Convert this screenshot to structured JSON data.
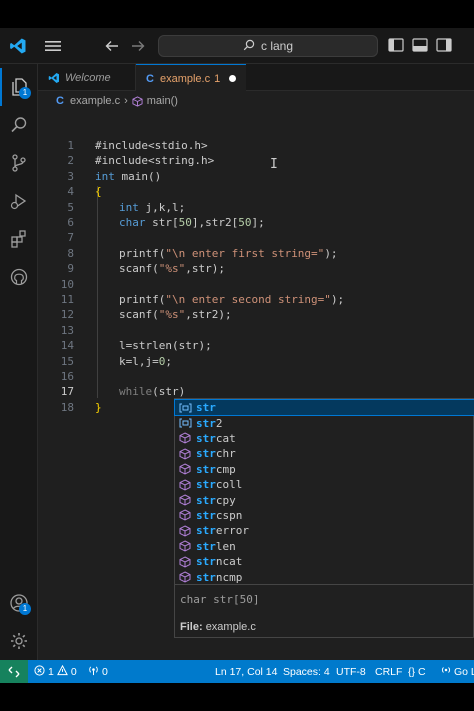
{
  "search": {
    "text": "c lang"
  },
  "activity": {
    "explorer_badge": "1",
    "account_badge": "1"
  },
  "tabs": [
    {
      "label": "Welcome"
    },
    {
      "label": "example.c",
      "problems": "1"
    }
  ],
  "breadcrumb": {
    "file": "example.c",
    "symbol": "main()"
  },
  "editor": {
    "current_line": 17,
    "lines": [
      "#include<stdio.h>",
      "#include<string.h>",
      "int main()",
      "{",
      "int j,k,l;",
      "char str[50],str2[50];",
      "",
      "printf(\"\\n enter first string=\");",
      "scanf(\"%s\",str);",
      "",
      "printf(\"\\n enter second string=\");",
      "scanf(\"%s\",str2);",
      "",
      "l=strlen(str);",
      "k=l,j=0;",
      "",
      "while(str)",
      "}"
    ]
  },
  "suggest": {
    "typed": "str",
    "items": [
      {
        "label": "str",
        "kind": "variable-icon"
      },
      {
        "label": "str2",
        "kind": "variable-icon"
      },
      {
        "label": "strcat",
        "kind": "function-icon"
      },
      {
        "label": "strchr",
        "kind": "function-icon"
      },
      {
        "label": "strcmp",
        "kind": "function-icon"
      },
      {
        "label": "strcoll",
        "kind": "function-icon"
      },
      {
        "label": "strcpy",
        "kind": "function-icon"
      },
      {
        "label": "strcspn",
        "kind": "function-icon"
      },
      {
        "label": "strerror",
        "kind": "function-icon"
      },
      {
        "label": "strlen",
        "kind": "function-icon"
      },
      {
        "label": "strncat",
        "kind": "function-icon"
      },
      {
        "label": "strncmp",
        "kind": "function-icon"
      }
    ],
    "detail_signature": "char str[50]",
    "detail_file_label": "File:",
    "detail_file_value": "example.c"
  },
  "status": {
    "errors": "1",
    "warnings": "0",
    "ports": "0",
    "position": "Ln 17, Col 14",
    "spaces": "Spaces: 4",
    "encoding": "UTF-8",
    "eol": "CRLF",
    "language": "C",
    "golive": "Go Li"
  },
  "colors": {
    "accent": "#0078d4",
    "statusbar": "#007acc",
    "remote": "#16825d",
    "keyword": "#569cd6",
    "string": "#ce9178",
    "function_icon": "#b180d7"
  }
}
